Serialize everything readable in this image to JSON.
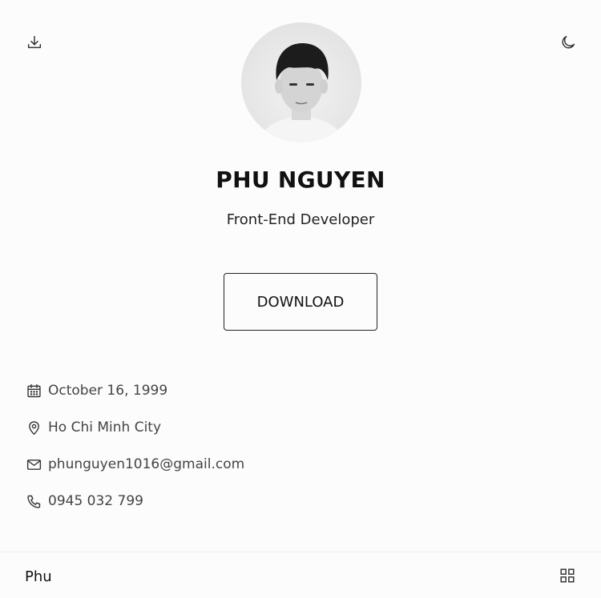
{
  "header": {
    "download_icon": "download-icon",
    "theme_icon": "moon-icon"
  },
  "profile": {
    "name": "PHU NGUYEN",
    "title": "Front-End Developer",
    "download_label": "DOWNLOAD"
  },
  "info": {
    "birthday": "October 16, 1999",
    "location": "Ho Chi Minh City",
    "email": "phunguyen1016@gmail.com",
    "phone": "0945 032 799"
  },
  "footer": {
    "logo": "Phu",
    "menu_icon": "grid-icon"
  },
  "colors": {
    "background": "#fcfcfc",
    "text": "#111111"
  }
}
